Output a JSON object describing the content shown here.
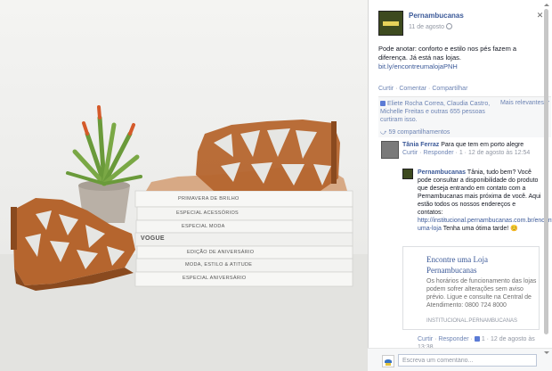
{
  "post": {
    "page_name": "Pernambucanas",
    "date": "11 de agosto",
    "text": "Pode anotar: conforto e estilo nos pés fazem a diferença. Já está nas lojas.",
    "link": "bit.ly/encontreumalojaPNH",
    "actions": [
      "Curtir",
      "Comentar",
      "Compartilhar"
    ]
  },
  "summary": {
    "likes_text": "Eliete Rocha Correa, Claudia Castro, Michelle Freitas e outras 655 pessoas curtiram isso.",
    "sort_label": "Mais relevantes",
    "shares_text": "59 compartilhamentos"
  },
  "comments": [
    {
      "author": "Tânia Ferraz",
      "text": "Para que tem em porto alegre",
      "actions": [
        "Curtir",
        "Responder"
      ],
      "meta": "1 · 12 de agosto às 12:54"
    }
  ],
  "reply": {
    "author": "Pernambucanas",
    "text": "Tânia, tudo bem? Você pode consultar a disponibilidade do produto que deseja entrando em contato com a Pernambucanas mais próxima de você. Aqui estão todos os nossos endereços e contatos:",
    "link": "http://institucional.pernambucanas.com.br/encontre-uma-loja",
    "tail": "Tenha uma ótima tarde! 😊",
    "card": {
      "title": "Encontre uma Loja Pernambucanas",
      "desc": "Os horários de funcionamento das lojas podem sofrer alterações sem aviso prévio. Ligue e consulte na Central de Atendimento: 0800 724 8000",
      "domain": "INSTITUCIONAL.PERNAMBUCANAS"
    },
    "actions": [
      "Curtir",
      "Responder"
    ],
    "meta": "1 · 12 de agosto às 13:38"
  },
  "composer": {
    "placeholder": "Escreva um comentário..."
  },
  "photo": {
    "books": [
      "PRIMAVERA DE BRILHO",
      "ESPECIAL ACESSÓRIOS",
      "ESPECIAL MODA",
      "VOGUE",
      "EDIÇÃO DE ANIVERSÁRIO",
      "MODA, ESTILO & ATITUDE",
      "ESPECIAL ANIVERSÁRIO"
    ],
    "colors": {
      "sandal": "#b5652e",
      "sandal_dark": "#8a4a1f",
      "pot": "#b9b0a6",
      "plant": "#6a9a3a",
      "plant_tip": "#d45a2a"
    }
  }
}
